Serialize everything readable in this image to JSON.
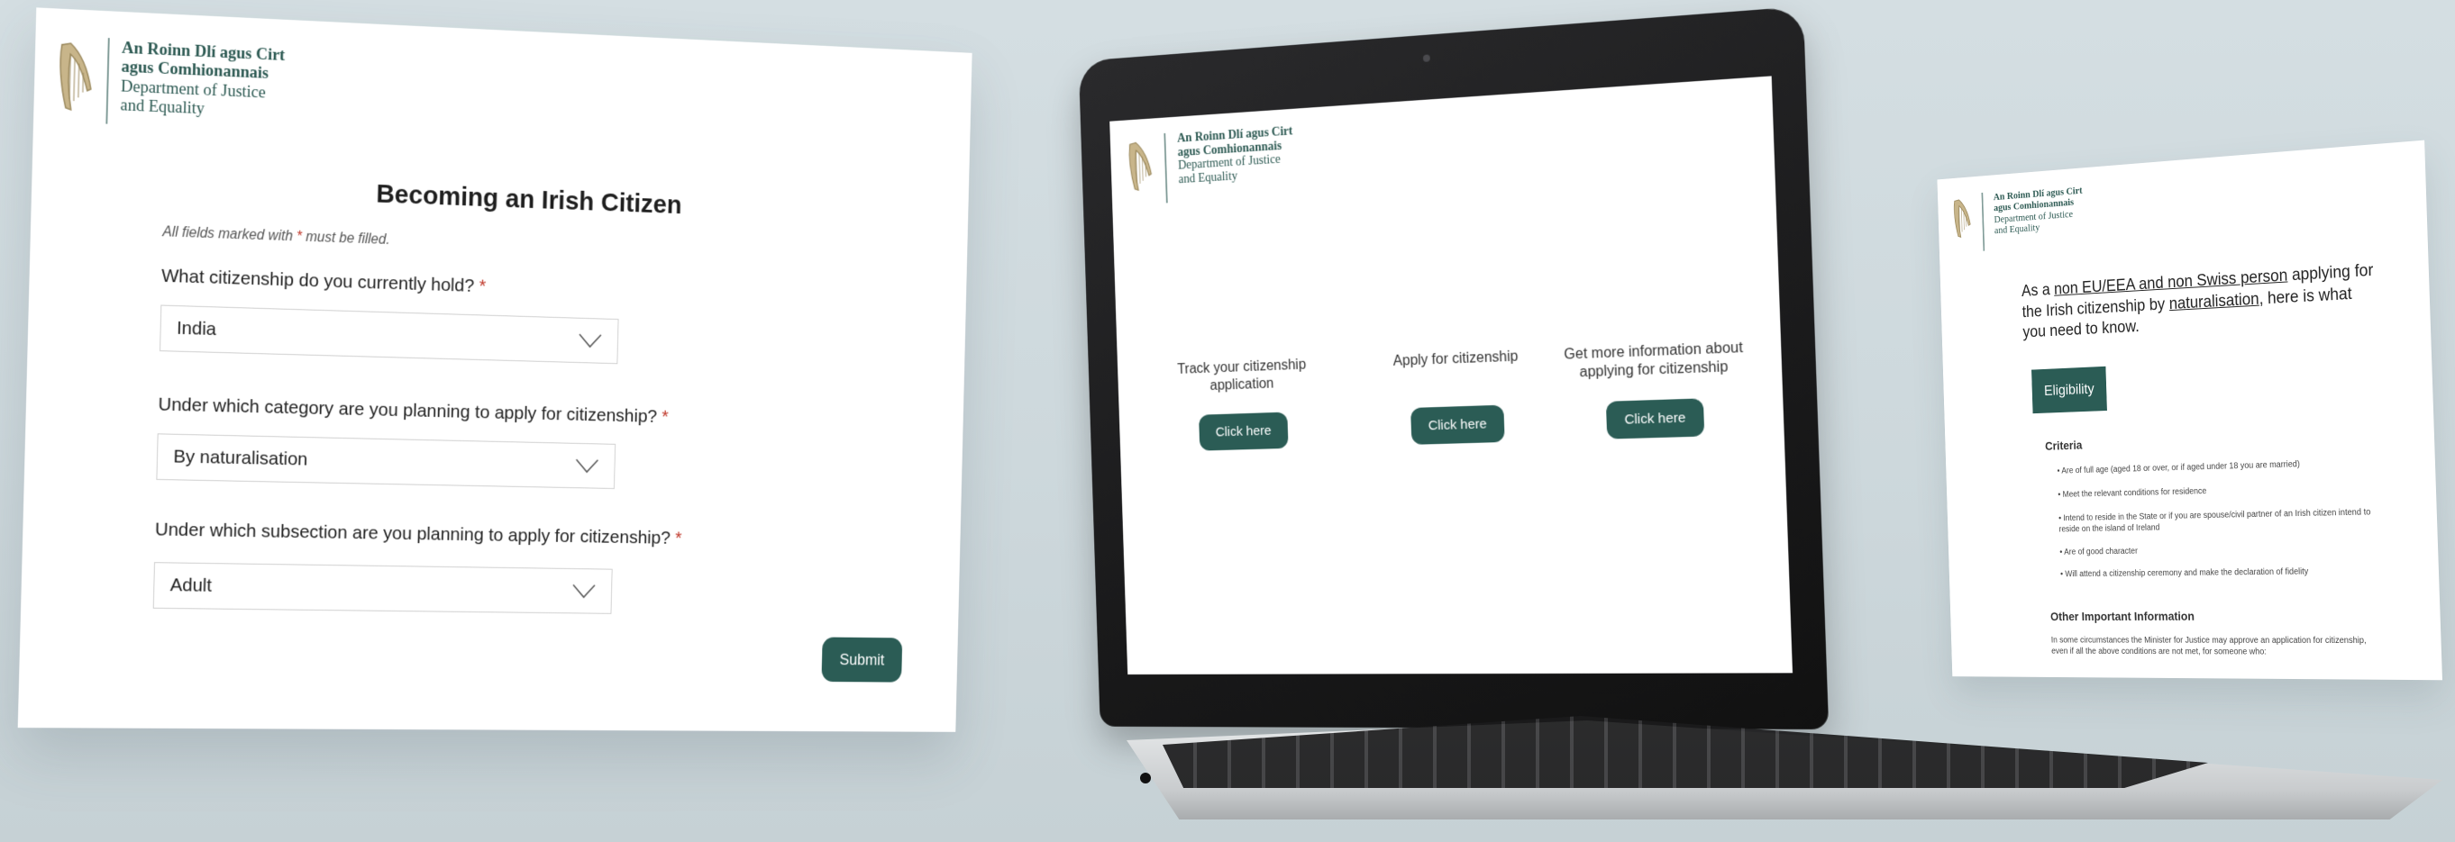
{
  "brand": {
    "line1": "An Roinn Dlí agus Cirt",
    "line2": "agus Comhionannais",
    "line3": "Department of Justice",
    "line4": "and Equality"
  },
  "form": {
    "title": "Becoming an Irish Citizen",
    "note_prefix": "All fields marked with ",
    "note_star": "*",
    "note_suffix": " must be filled.",
    "questions": [
      {
        "label": "What citizenship do you currently hold?",
        "star": "*",
        "value": "India"
      },
      {
        "label": "Under which category are you planning to apply for citizenship?",
        "star": "*",
        "value": "By naturalisation"
      },
      {
        "label": "Under which subsection are you planning to apply for citizenship?",
        "star": "*",
        "value": "Adult"
      }
    ],
    "submit_label": "Submit"
  },
  "laptop": {
    "options": [
      {
        "label": "Track your citizenship application",
        "button": "Click here"
      },
      {
        "label": "Apply for citizenship",
        "button": "Click here"
      },
      {
        "label": "Get more information about applying for citizenship",
        "button": "Click here"
      }
    ]
  },
  "info": {
    "intro_a": "As a ",
    "intro_link1": "non EU/EEA and non Swiss person",
    "intro_b": " applying for the Irish citizenship by ",
    "intro_link2": "naturalisation",
    "intro_c": ", here is what you need to know.",
    "eligibility_label": "Eligibility",
    "criteria_heading": "Criteria",
    "criteria": [
      "• Are of full age (aged 18 or over, or if aged under 18 you are married)",
      "• Meet the relevant conditions for residence",
      "• Intend to reside in the State or if you are spouse/civil partner of an Irish citizen intend to reside on the island of Ireland",
      "• Are of good character",
      "• Will attend a citizenship ceremony and make the declaration of fidelity"
    ],
    "other_heading": "Other Important Information",
    "other_text": "In some circumstances the Minister for Justice may approve an application for citizenship, even if all the above conditions are not met, for someone who:"
  },
  "colors": {
    "brand_green": "#2b5c55",
    "required_red": "#c0392b"
  }
}
